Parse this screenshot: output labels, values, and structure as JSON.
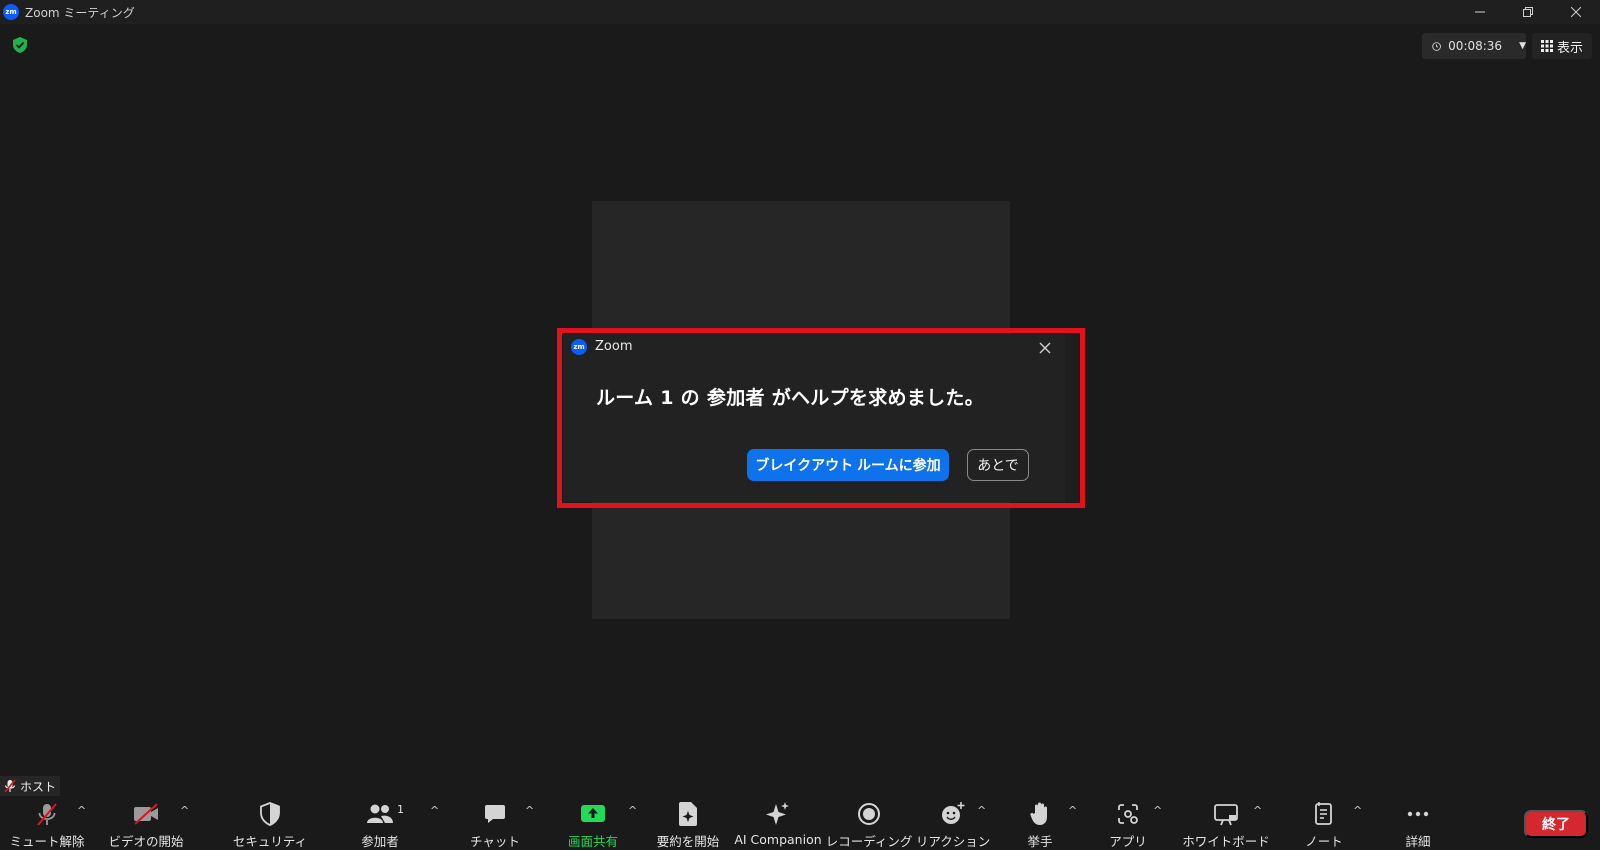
{
  "window": {
    "app_logo": "zm",
    "title": "Zoom ミーティング",
    "controls": [
      "minimize-icon",
      "restore-icon",
      "close-icon"
    ]
  },
  "top_bar": {
    "timer": "00:08:36",
    "view_label": "表示"
  },
  "dialog": {
    "logo": "zm",
    "title": "Zoom",
    "message": "ルーム 1 の 参加者 がヘルプを求めました。",
    "primary_button": "ブレイクアウト ルームに参加",
    "secondary_button": "あとで",
    "highlight_color": "#e0131d"
  },
  "host_badge": {
    "label": "ホスト"
  },
  "toolbar": {
    "items": [
      {
        "label": "ミュート解除",
        "icon": "mic-muted-icon"
      },
      {
        "label": "ビデオの開始",
        "icon": "video-off-icon"
      },
      {
        "label": "セキュリティ",
        "icon": "shield-icon"
      },
      {
        "label": "参加者",
        "icon": "participants-icon",
        "count": "1"
      },
      {
        "label": "チャット",
        "icon": "chat-icon"
      },
      {
        "label": "画面共有",
        "icon": "share-screen-icon"
      },
      {
        "label": "要約を開始",
        "icon": "summary-icon"
      },
      {
        "label": "AI Companion",
        "icon": "sparkle-icon"
      },
      {
        "label": "レコーディング",
        "icon": "record-icon"
      },
      {
        "label": "リアクション",
        "icon": "reaction-icon"
      },
      {
        "label": "挙手",
        "icon": "raise-hand-icon"
      },
      {
        "label": "アプリ",
        "icon": "apps-icon"
      },
      {
        "label": "ホワイトボード",
        "icon": "whiteboard-icon"
      },
      {
        "label": "ノート",
        "icon": "notes-icon"
      },
      {
        "label": "詳細",
        "icon": "more-icon"
      }
    ],
    "end_label": "終了",
    "share_color": "#23d959",
    "end_color": "#d4282e"
  }
}
